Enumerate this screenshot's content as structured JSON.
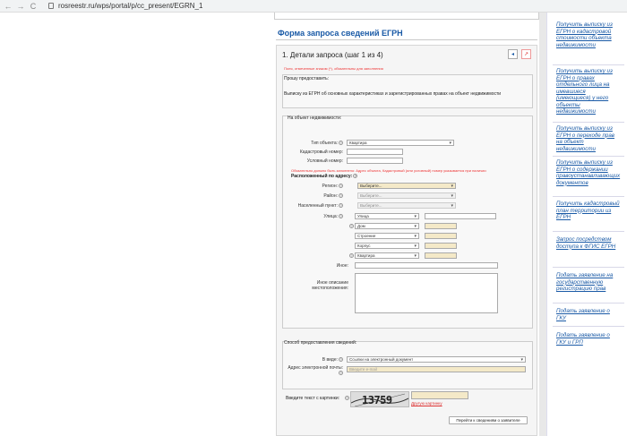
{
  "browser": {
    "back": "←",
    "forward": "→",
    "reload": "C",
    "url": "rosreestr.ru/wps/portal/p/cc_present/EGRN_1"
  },
  "form": {
    "title": "Форма запроса сведений ЕГРН",
    "step": "1. Детали запроса (шаг 1 из 4)",
    "required_note": "Поля, отмеченные знаком (*), обязательны для заполнения",
    "request_box": {
      "label": "Прошу предоставить:",
      "text": "Выписку из ЕГРН об основных характеристиках и зарегистрированных правах на объект недвижимости"
    },
    "object": {
      "label": "На объект недвижимости:",
      "type_label": "Тип объекта:",
      "type_value": "Квартира",
      "cadastral_label": "Кадастровый номер:",
      "cadastral_value": "",
      "conditional_label": "Условный номер:",
      "conditional_value": "",
      "warning": "Обязательно должно быть заполнено: Адрес объекта, Кадастровый (или условный) номер указывается при наличии",
      "address_label": "Расположенный по адресу:",
      "region_label": "Регион:",
      "region_value": "Выберите...",
      "district_label": "Район:",
      "district_value": "Выберите...",
      "settlement_label": "Населенный пункт:",
      "settlement_value": "Выберите...",
      "street_label": "Улица:",
      "street_value": "Улица",
      "house_value": "Дом",
      "building_value": "Строение",
      "korpus_value": "Корпус",
      "flat_value": "Квартира",
      "other_label": "Иное:",
      "other_desc_label": "Иное описание местоположения:"
    },
    "delivery": {
      "label": "Способ предоставления сведений:",
      "kind_label": "В виде:",
      "kind_value": "Ссылки на электронный документ",
      "email_label": "Адрес электронной почты:",
      "email_placeholder": "Введите e-mail"
    },
    "captcha": {
      "label": "Введите текст с картинки:",
      "text": "13759",
      "refresh_link": "Другую картинку",
      "input_value": ""
    },
    "next_button": "Перейти к сведениям о заявителе"
  },
  "right_menu": [
    "Получить выписку из ЕГРН о кадастровой стоимости объекта недвижимости",
    "Получить выписку из ЕГРН о правах отдельного лица на имевшиеся (имеющиеся) у него объекты недвижимости",
    "Получить выписку из ЕГРН о переходе прав на объект недвижимости",
    "Получить выписку из ЕГРН о содержании правоустанавливающих документов",
    "Получить кадастровый план территории из ЕГРН",
    "Запрос посредством доступа к ФГИС ЕГРН",
    "Подать заявление на государственную регистрацию прав",
    "Подать заявление о ГКУ",
    "Подать заявление о ГКУ и ГРП"
  ]
}
